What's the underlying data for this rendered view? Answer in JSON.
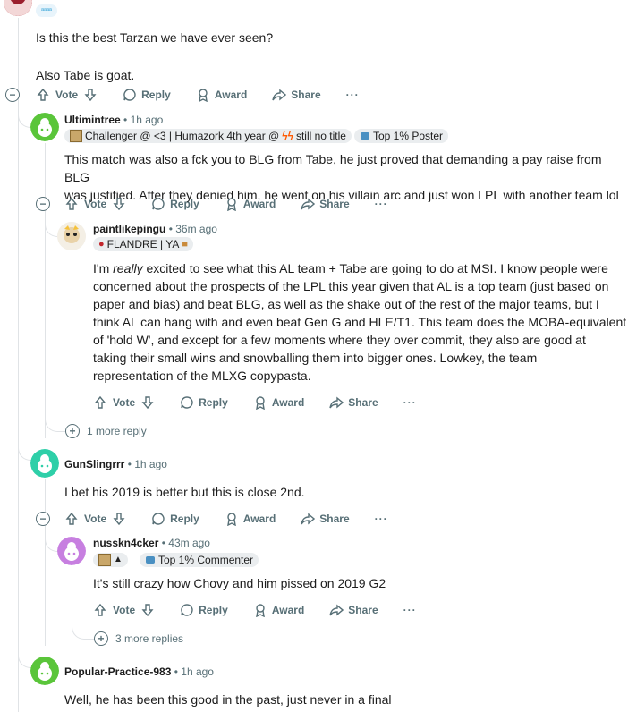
{
  "top_comment": {
    "flair_text": "ᵃᵃᵃᵃ",
    "lines": [
      "Is this the best Tarzan we have ever seen?",
      "Also Tabe is goat."
    ],
    "actions": {
      "vote": "Vote",
      "reply": "Reply",
      "award": "Award",
      "share": "Share",
      "more": "···"
    }
  },
  "comments": [
    {
      "username": "Ultimintree",
      "time": "1h ago",
      "flair": "Challenger @ <3 | Humazork 4th year @ ",
      "flair_tail": "still no title",
      "badge": "Top 1% Poster",
      "lines": [
        "This match was also a fck you to BLG from Tabe, he just proved that demanding a pay raise from BLG",
        "was justified. After they denied him, he went on his villain arc and just won LPL with another team lol"
      ],
      "actions": {
        "vote": "Vote",
        "reply": "Reply",
        "award": "Award",
        "share": "Share"
      }
    },
    {
      "username": "paintlikepingu",
      "time": "36m ago",
      "flair": "FLANDRE | YA",
      "lines_pre": "I'm ",
      "lines_em": "really",
      "lines_post": " excited to see what this AL team + Tabe are going to do at MSI. I know people were",
      "lines": [
        "concerned about the prospects of the LPL this year given that AL is a top team (just based on",
        "paper and bias) and beat BLG, as well as the shake out of the rest of the major teams, but I",
        "think AL can hang with and even beat Gen G and HLE/T1. This team does the MOBA-equivalent",
        "of 'hold W', and except for a few moments where they over commit, they also are good at",
        "taking their small wins and snowballing them into bigger ones. Lowkey, the team",
        "representation of the MLXG copypasta."
      ],
      "actions": {
        "vote": "Vote",
        "reply": "Reply",
        "award": "Award",
        "share": "Share"
      }
    },
    {
      "more_replies": "1 more reply"
    },
    {
      "username": "GunSlingrrr",
      "time": "1h ago",
      "lines": [
        "I bet his 2019 is better but this is close 2nd."
      ],
      "actions": {
        "vote": "Vote",
        "reply": "Reply",
        "award": "Award",
        "share": "Share"
      }
    },
    {
      "username": "nusskn4cker",
      "time": "43m ago",
      "badge": "Top 1% Commenter",
      "lines": [
        "It's still crazy how Chovy and him pissed on 2019 G2"
      ],
      "actions": {
        "vote": "Vote",
        "reply": "Reply",
        "award": "Award",
        "share": "Share"
      }
    },
    {
      "more_replies": "3 more replies"
    },
    {
      "username": "Popular-Practice-983",
      "time": "1h ago",
      "lines": [
        "Well, he has been this good in the past, just never in a final"
      ]
    }
  ]
}
